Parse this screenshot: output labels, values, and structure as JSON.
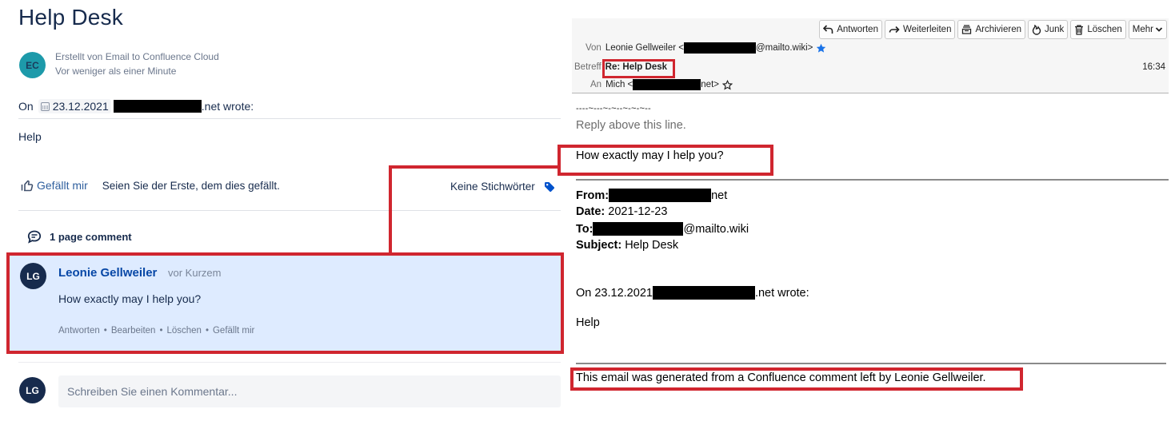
{
  "confluence": {
    "page_title": "Help Desk",
    "byline": {
      "avatar_initials": "EC",
      "created_by": "Erstellt von Email to Confluence Cloud",
      "created_when": "Vor weniger als einer Minute"
    },
    "quote_line": {
      "prefix": "On",
      "date": "23.12.2021",
      "suffix": ".net wrote:"
    },
    "body_text": "Help",
    "like_button_label": "Gefällt mir",
    "like_info": "Seien Sie der Erste, dem dies gefällt.",
    "labels_text": "Keine Stichwörter",
    "comments_header": "1 page comment",
    "comment": {
      "avatar_initials": "LG",
      "author": "Leonie Gellweiler",
      "time": "vor Kurzem",
      "body": "How exactly may I help you?",
      "actions": [
        "Antworten",
        "Bearbeiten",
        "Löschen",
        "Gefällt mir"
      ]
    },
    "reply": {
      "avatar_initials": "LG",
      "placeholder": "Schreiben Sie einen Kommentar..."
    }
  },
  "email": {
    "toolbar": [
      {
        "icon": "reply-icon",
        "label": "Antworten"
      },
      {
        "icon": "forward-icon",
        "label": "Weiterleiten"
      },
      {
        "icon": "archive-icon",
        "label": "Archivieren"
      },
      {
        "icon": "junk-icon",
        "label": "Junk"
      },
      {
        "icon": "trash-icon",
        "label": "Löschen"
      },
      {
        "icon": "chevron-down-icon",
        "label": "Mehr"
      }
    ],
    "from_label": "Von",
    "from_name": "Leonie Gellweiler <",
    "from_suffix": "@mailto.wiki>",
    "subject_label": "Betreff",
    "subject": "Re: Help Desk",
    "to_label": "An",
    "to_name": "Mich <",
    "to_suffix": "net>",
    "time": "16:34",
    "body": {
      "tilde_line": "----~---~-~--~-~-~--",
      "reply_above": "Reply above this line.",
      "message": "How exactly may I help you?",
      "from_label": "From:",
      "from_suffix": "net",
      "date_label": "Date:",
      "date_value": "2021-12-23",
      "to_label": "To:",
      "to_suffix": "@mailto.wiki",
      "subject_label": "Subject:",
      "subject_value": "Help Desk",
      "quote_prefix": "On 23.12.2021",
      "quote_suffix": ".net wrote:",
      "quote_body": "Help",
      "footer_note": "This email was generated from a Confluence comment left by Leonie Gellweiler."
    }
  },
  "colors": {
    "annotation_red": "#d0262f",
    "comment_highlight": "#deebff",
    "link_blue": "#0747a6",
    "star_blue": "#1a73e8"
  }
}
